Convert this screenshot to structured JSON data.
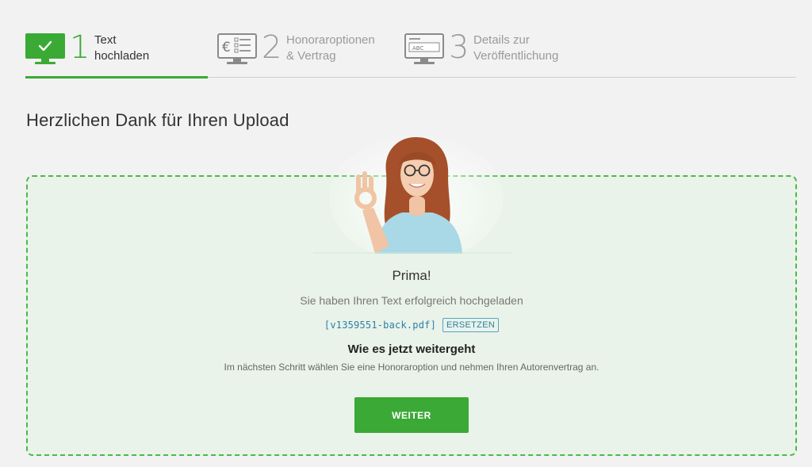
{
  "stepper": {
    "steps": [
      {
        "number": "1",
        "label_line1": "Text",
        "label_line2": "hochladen",
        "state": "done",
        "icon": "monitor-check-icon"
      },
      {
        "number": "2",
        "label_line1": "Honoraroptionen",
        "label_line2": "& Vertrag",
        "state": "todo",
        "icon": "monitor-euro-list-icon"
      },
      {
        "number": "3",
        "label_line1": "Details zur",
        "label_line2": "Veröffentlichung",
        "state": "todo",
        "icon": "monitor-abc-icon"
      }
    ]
  },
  "page": {
    "title": "Herzlichen Dank für Ihren Upload"
  },
  "upload": {
    "headline": "Prima!",
    "success_message": "Sie haben Ihren Text erfolgreich hochgeladen",
    "file_name": "[v1359551-back.pdf]",
    "replace_label": "ERSETZEN",
    "next_title": "Wie es jetzt weitergeht",
    "next_description": "Im nächsten Schritt wählen Sie eine Honoraroption und nehmen Ihren Autorenvertrag an.",
    "continue_label": "WEITER",
    "icon_box_text": "ABC",
    "icon_euro": "€"
  },
  "colors": {
    "accent_green": "#3aaa35",
    "panel_bg": "#e9f3e9",
    "link_blue": "#2c7fa8"
  }
}
